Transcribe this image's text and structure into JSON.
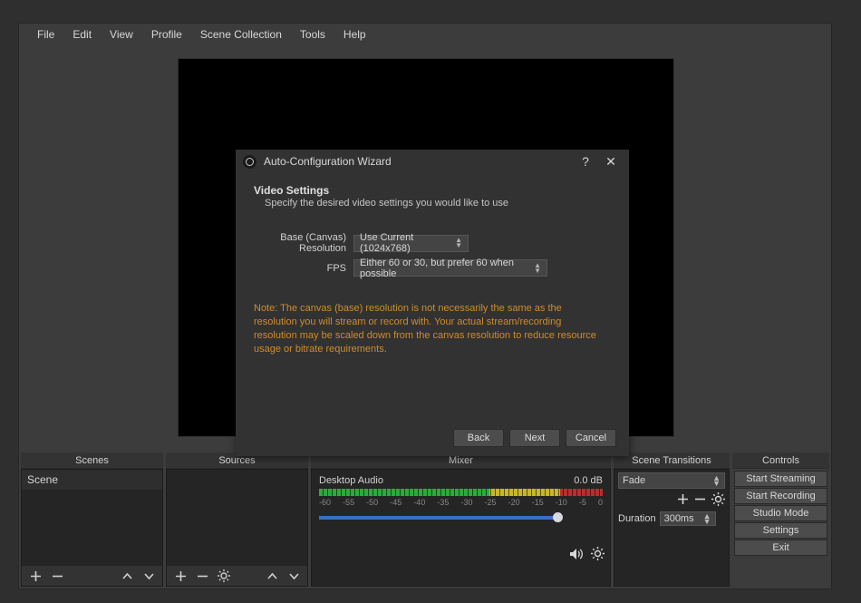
{
  "menu": {
    "file": "File",
    "edit": "Edit",
    "view": "View",
    "profile": "Profile",
    "scene_collection": "Scene Collection",
    "tools": "Tools",
    "help": "Help"
  },
  "panels": {
    "scenes": {
      "title": "Scenes",
      "items": [
        "Scene"
      ]
    },
    "sources": {
      "title": "Sources"
    },
    "mixer": {
      "title": "Mixer",
      "track_name": "Desktop Audio",
      "db": "0.0 dB",
      "ticks": [
        "-60",
        "-55",
        "-50",
        "-45",
        "-40",
        "-35",
        "-30",
        "-25",
        "-20",
        "-15",
        "-10",
        "-5",
        "0"
      ]
    },
    "transitions": {
      "title": "Scene Transitions",
      "mode": "Fade",
      "duration_label": "Duration",
      "duration_value": "300ms"
    },
    "controls": {
      "title": "Controls",
      "start_streaming": "Start Streaming",
      "start_recording": "Start Recording",
      "studio_mode": "Studio Mode",
      "settings": "Settings",
      "exit": "Exit"
    }
  },
  "dialog": {
    "title": "Auto-Configuration Wizard",
    "help": "?",
    "close": "✕",
    "heading": "Video Settings",
    "sub": "Specify the desired video settings you would like to use",
    "label_res": "Base (Canvas) Resolution",
    "value_res": "Use Current (1024x768)",
    "label_fps": "FPS",
    "value_fps": "Either 60 or 30, but prefer 60 when possible",
    "note": "Note: The canvas (base) resolution is not necessarily the same as the resolution you will stream or record with.  Your actual stream/recording resolution may be scaled down from the canvas resolution to reduce resource usage or bitrate requirements.",
    "back": "Back",
    "next": "Next",
    "cancel": "Cancel"
  }
}
